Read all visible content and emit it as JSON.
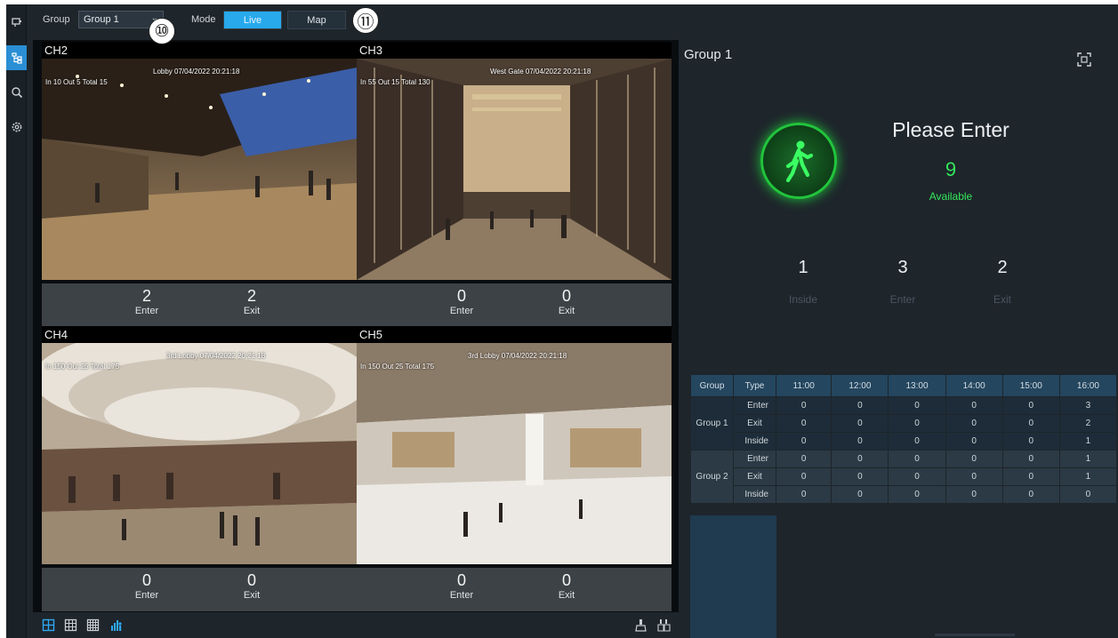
{
  "topbar": {
    "group_label": "Group",
    "group_value": "Group 1",
    "mode_label": "Mode",
    "mode_live": "Live",
    "mode_map": "Map"
  },
  "callouts": [
    "⑩",
    "⑪"
  ],
  "cameras": [
    {
      "title": "CH2",
      "osd_top": "Lobby 07/04/2022 20:21:18",
      "osd_left": "In 10  Out 5  Total 15",
      "enter": "2",
      "exit": "2"
    },
    {
      "title": "CH3",
      "osd_top": "West Gate 07/04/2022 20:21:18",
      "osd_left": "In 55  Out 15  Total 130",
      "enter": "0",
      "exit": "0"
    },
    {
      "title": "CH4",
      "osd_top": "3rd Lobby 07/04/2022 20:21:18",
      "osd_left": "In 150  Out 25  Total 175",
      "enter": "0",
      "exit": "0"
    },
    {
      "title": "CH5",
      "osd_top": "3rd Lobby 07/04/2022 20:21:18",
      "osd_left": "In 150  Out 25  Total 175",
      "enter": "0",
      "exit": "0"
    }
  ],
  "count_labels": {
    "enter": "Enter",
    "exit": "Exit"
  },
  "panel": {
    "title": "Group 1",
    "message": "Please Enter",
    "available_count": "9",
    "available_label": "Available",
    "inside": "1",
    "inside_label": "Inside",
    "enter": "3",
    "enter_label": "Enter",
    "exit": "2",
    "exit_label": "Exit"
  },
  "table": {
    "headers": [
      "Group",
      "Type",
      "11:00",
      "12:00",
      "13:00",
      "14:00",
      "15:00",
      "16:00"
    ],
    "groups": [
      {
        "name": "Group 1",
        "rows": [
          {
            "type": "Enter",
            "values": [
              "0",
              "0",
              "0",
              "0",
              "0",
              "3"
            ]
          },
          {
            "type": "Exit",
            "values": [
              "0",
              "0",
              "0",
              "0",
              "0",
              "2"
            ]
          },
          {
            "type": "Inside",
            "values": [
              "0",
              "0",
              "0",
              "0",
              "0",
              "1"
            ]
          }
        ]
      },
      {
        "name": "Group 2",
        "rows": [
          {
            "type": "Enter",
            "values": [
              "0",
              "0",
              "0",
              "0",
              "0",
              "1"
            ]
          },
          {
            "type": "Exit",
            "values": [
              "0",
              "0",
              "0",
              "0",
              "0",
              "1"
            ]
          },
          {
            "type": "Inside",
            "values": [
              "0",
              "0",
              "0",
              "0",
              "0",
              "0"
            ]
          }
        ]
      }
    ]
  },
  "icons": {
    "rail": [
      "monitor-icon",
      "group-tree-icon",
      "search-icon",
      "settings-icon"
    ],
    "bottom": [
      "layout-4-icon",
      "layout-9-icon",
      "layout-16-icon",
      "people-count-icon",
      "clear-icon",
      "clear-all-icon"
    ]
  },
  "colors": {
    "accent": "#27a9ec",
    "available": "#33e65a",
    "table_header": "#24465f"
  }
}
